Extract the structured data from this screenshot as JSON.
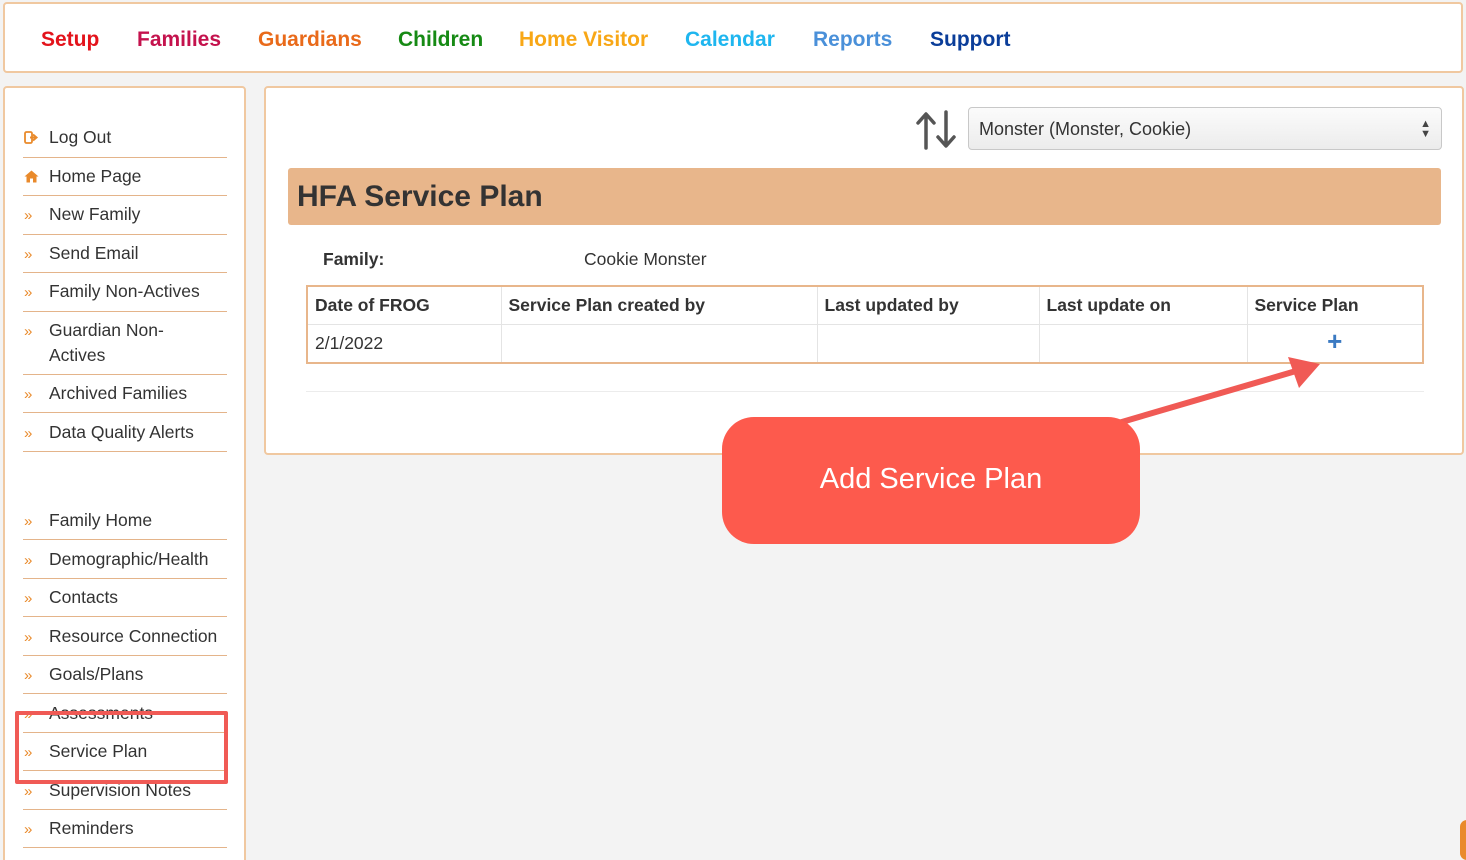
{
  "topnav": [
    {
      "label": "Setup",
      "color": "#e3131b"
    },
    {
      "label": "Families",
      "color": "#c4124d"
    },
    {
      "label": "Guardians",
      "color": "#e96a1a"
    },
    {
      "label": "Children",
      "color": "#168a14"
    },
    {
      "label": "Home Visitor",
      "color": "#f8a716"
    },
    {
      "label": "Calendar",
      "color": "#1fb6ef"
    },
    {
      "label": "Reports",
      "color": "#4a90d9"
    },
    {
      "label": "Support",
      "color": "#0a3d99"
    }
  ],
  "sidebar": {
    "items": [
      {
        "label": "Log Out",
        "icon": "sign-out-icon"
      },
      {
        "label": "Home Page",
        "icon": "home-icon"
      },
      {
        "label": "New Family",
        "icon": "double-chevron-icon"
      },
      {
        "label": "Send Email",
        "icon": "double-chevron-icon"
      },
      {
        "label": "Family Non-Actives",
        "icon": "double-chevron-icon"
      },
      {
        "label": "Guardian Non-Actives",
        "icon": "double-chevron-icon"
      },
      {
        "label": "Archived Families",
        "icon": "double-chevron-icon"
      },
      {
        "label": "Data Quality Alerts",
        "icon": "double-chevron-icon"
      },
      {
        "label": "Family Home",
        "icon": "double-chevron-icon"
      },
      {
        "label": "Demographic/Health",
        "icon": "double-chevron-icon"
      },
      {
        "label": "Contacts",
        "icon": "double-chevron-icon"
      },
      {
        "label": "Resource Connection",
        "icon": "double-chevron-icon"
      },
      {
        "label": "Goals/Plans",
        "icon": "double-chevron-icon"
      },
      {
        "label": "Assessments",
        "icon": "double-chevron-icon"
      },
      {
        "label": "Service Plan",
        "icon": "double-chevron-icon"
      },
      {
        "label": "Supervision Notes",
        "icon": "double-chevron-icon"
      },
      {
        "label": "Reminders",
        "icon": "double-chevron-icon"
      }
    ]
  },
  "main": {
    "select_value": "Monster (Monster, Cookie)",
    "title": "HFA Service Plan",
    "family_label": "Family:",
    "family_value": "Cookie Monster",
    "table": {
      "headers": [
        "Date of FROG",
        "Service Plan created by",
        "Last updated by",
        "Last update on",
        "Service Plan"
      ],
      "rows": [
        {
          "date": "2/1/2022",
          "created_by": "",
          "updated_by": "",
          "updated_on": "",
          "action_icon": "plus-icon"
        }
      ]
    }
  },
  "annotation": {
    "callout_text": "Add Service Plan",
    "callout_color": "#fd5a4d",
    "highlight_color": "#f05a55"
  },
  "colors": {
    "accent_orange": "#e98a2b",
    "panel_border": "#f0c8a0",
    "title_bar": "#e8b68b",
    "plus_blue": "#3b7ac2"
  }
}
